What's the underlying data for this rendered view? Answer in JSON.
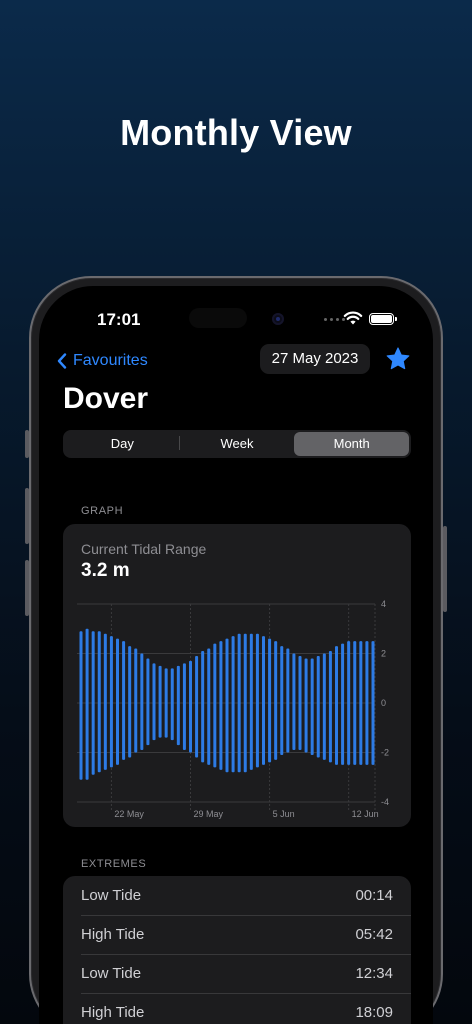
{
  "headline": "Monthly View",
  "status_bar": {
    "time": "17:01"
  },
  "nav": {
    "back_label": "Favourites",
    "date": "27 May 2023",
    "favourite_icon": "star-icon"
  },
  "location": "Dover",
  "segments": [
    {
      "label": "Day",
      "selected": false
    },
    {
      "label": "Week",
      "selected": false
    },
    {
      "label": "Month",
      "selected": true
    }
  ],
  "graph": {
    "section_label": "GRAPH",
    "subtitle": "Current Tidal Range",
    "value": "3.2 m"
  },
  "chart_data": {
    "type": "bar",
    "subtype": "floating-range",
    "y_ticks": [
      "4",
      "2",
      "0",
      "-2",
      "-4"
    ],
    "ylim": [
      -4,
      4
    ],
    "x_ticks": [
      "22 May",
      "29 May",
      "5 Jun",
      "12 Jun"
    ],
    "color": "#2d7be5",
    "grid": true,
    "highs": [
      2.9,
      3.0,
      2.9,
      2.9,
      2.8,
      2.7,
      2.6,
      2.5,
      2.3,
      2.2,
      2.0,
      1.8,
      1.6,
      1.5,
      1.4,
      1.4,
      1.5,
      1.6,
      1.7,
      1.9,
      2.1,
      2.2,
      2.4,
      2.5,
      2.6,
      2.7,
      2.8,
      2.8,
      2.8,
      2.8,
      2.7,
      2.6,
      2.5,
      2.3,
      2.2,
      2.0,
      1.9,
      1.8,
      1.8,
      1.9,
      2.0,
      2.1,
      2.3,
      2.4,
      2.5,
      2.5,
      2.5,
      2.5,
      2.5
    ],
    "lows": [
      -3.1,
      -3.1,
      -2.9,
      -2.8,
      -2.7,
      -2.6,
      -2.5,
      -2.3,
      -2.2,
      -2.0,
      -1.9,
      -1.7,
      -1.5,
      -1.4,
      -1.4,
      -1.5,
      -1.7,
      -1.9,
      -2.0,
      -2.2,
      -2.4,
      -2.5,
      -2.6,
      -2.7,
      -2.8,
      -2.8,
      -2.8,
      -2.8,
      -2.7,
      -2.6,
      -2.5,
      -2.4,
      -2.3,
      -2.1,
      -2.0,
      -1.9,
      -1.9,
      -2.0,
      -2.1,
      -2.2,
      -2.3,
      -2.4,
      -2.5,
      -2.5,
      -2.5,
      -2.5,
      -2.5,
      -2.5,
      -2.5
    ]
  },
  "extremes": {
    "section_label": "EXTREMES",
    "rows": [
      {
        "type": "Low Tide",
        "time": "00:14"
      },
      {
        "type": "High Tide",
        "time": "05:42"
      },
      {
        "type": "Low Tide",
        "time": "12:34"
      },
      {
        "type": "High Tide",
        "time": "18:09"
      }
    ]
  }
}
